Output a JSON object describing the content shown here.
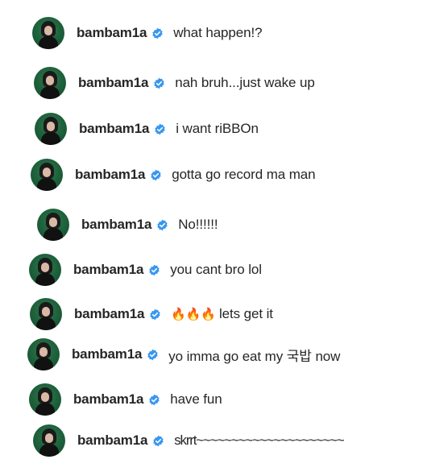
{
  "colors": {
    "badge_blue": "#3897f0",
    "avatar_green": "#1c5f3a",
    "text": "#262626"
  },
  "icons": {
    "verified": "verified-badge-icon",
    "flame": "fire-emoji"
  },
  "comments": [
    {
      "username": "bambam1a",
      "text": "what happen!?"
    },
    {
      "username": "bambam1a",
      "text": "nah bruh...just wake up"
    },
    {
      "username": "bambam1a",
      "text": "i want riBBOn"
    },
    {
      "username": "bambam1a",
      "text": "gotta go record ma man"
    },
    {
      "username": "bambam1a",
      "text": "No!!!!!!"
    },
    {
      "username": "bambam1a",
      "text": "you cant bro lol"
    },
    {
      "username": "bambam1a",
      "emoji": "🔥🔥🔥",
      "text": "lets get it"
    },
    {
      "username": "bambam1a",
      "text": "yo imma go eat my 국밥 now"
    },
    {
      "username": "bambam1a",
      "text": "have fun"
    },
    {
      "username": "bambam1a",
      "text": "skrrt~~~~~~~~~~~~~~~~~~~~~"
    }
  ]
}
